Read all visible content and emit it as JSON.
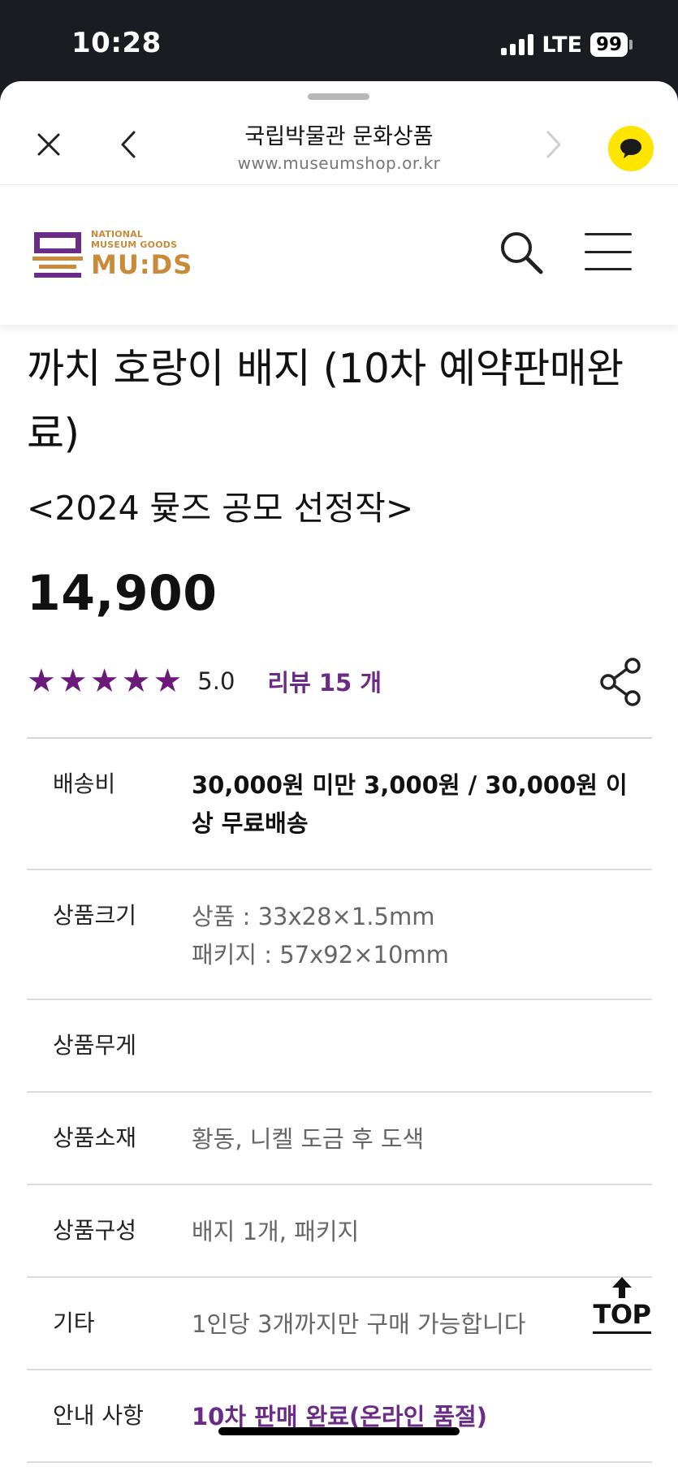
{
  "status_bar": {
    "time": "10:28",
    "network": "LTE",
    "battery": "99"
  },
  "browser_nav": {
    "title": "국립박물관 문화상품",
    "url": "www.museumshop.or.kr",
    "close_icon": "close-icon",
    "back_icon": "chevron-left-icon",
    "forward_icon": "chevron-right-icon",
    "chat_icon": "kakao-chat-icon"
  },
  "site_header": {
    "logo_small_1": "NATIONAL",
    "logo_small_2": "MUSEUM GOODS",
    "logo_big": "MU:DS",
    "search_icon": "search-icon",
    "menu_icon": "hamburger-menu-icon"
  },
  "product": {
    "title": "까치 호랑이 배지 (10차 예약판매완료)",
    "subtitle": "<2024 뮻즈 공모 선정작>",
    "price": "14,900",
    "rating_stars": 5,
    "rating_score": "5.0",
    "review_label": "리뷰 15 개",
    "share_icon": "share-icon"
  },
  "details": [
    {
      "label": "배송비",
      "value": "30,000원 미만 3,000원 / 30,000원 이상 무료배송",
      "style": "bold"
    },
    {
      "label": "상품크기",
      "value_lines": [
        "상품 : 33x28×1.5mm",
        "패키지 : 57x92×10mm"
      ],
      "style": "normal"
    },
    {
      "label": "상품무게",
      "value": "",
      "style": "normal"
    },
    {
      "label": "상품소재",
      "value": "황동, 니켈 도금 후 도색",
      "style": "normal"
    },
    {
      "label": "상품구성",
      "value": "배지 1개, 패키지",
      "style": "normal"
    },
    {
      "label": "기타",
      "value": "1인당 3개까지만 구매 가능합니다",
      "style": "normal"
    },
    {
      "label": "안내 사항",
      "value": "10차 판매 완료(온라인 품절)",
      "style": "purple"
    }
  ],
  "top_button": {
    "label": "TOP",
    "icon": "arrow-up-icon"
  },
  "colors": {
    "accent_purple": "#6a2c86",
    "star_purple": "#6a1b7a",
    "logo_gold": "#c98a3a",
    "kakao_yellow": "#fee500"
  }
}
